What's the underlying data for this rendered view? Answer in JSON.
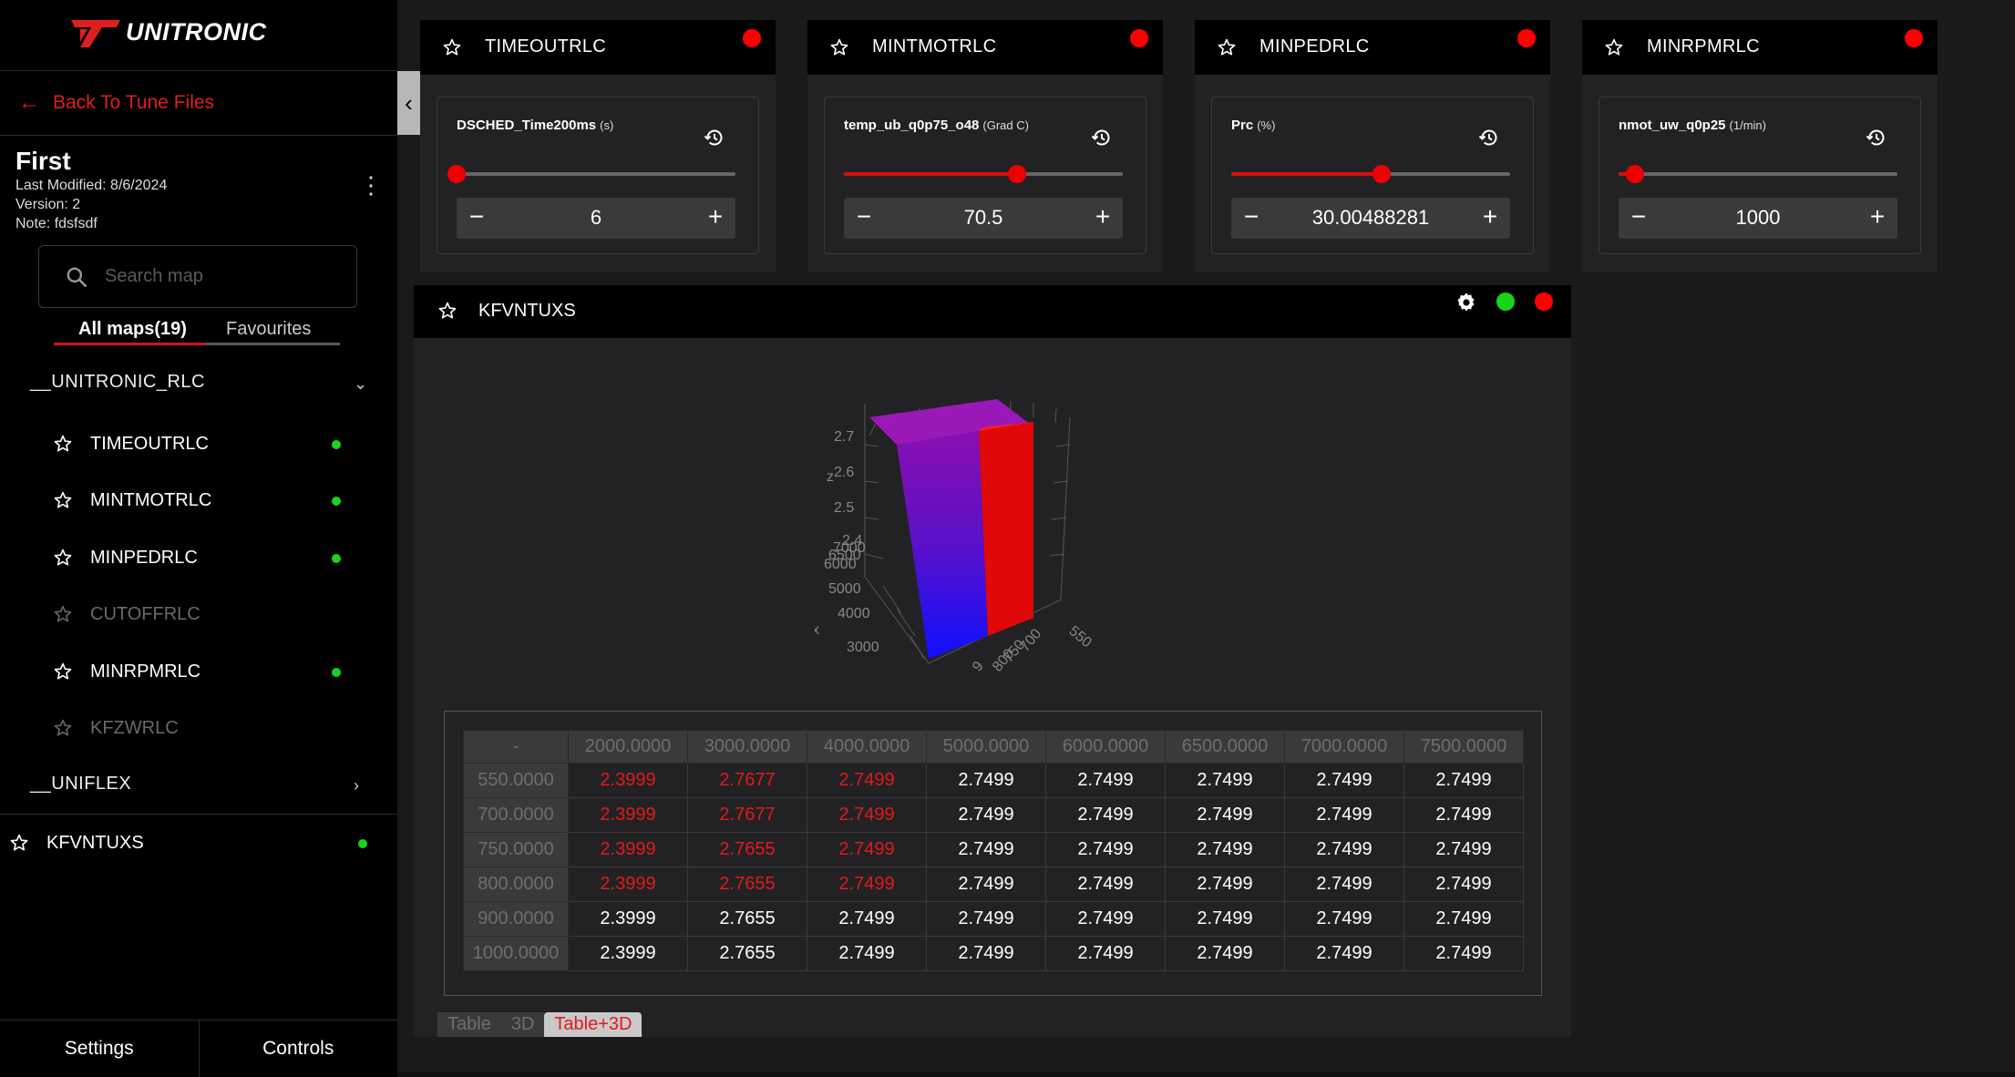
{
  "brand": {
    "name": "UNITRONIC",
    "accent": "#e01e1e"
  },
  "sidebar": {
    "back_label": "Back To Tune Files",
    "tune": {
      "title": "First",
      "last_modified": "Last Modified: 8/6/2024",
      "version": "Version: 2",
      "note": "Note: fdsfsdf"
    },
    "search_placeholder": "Search map",
    "tabs": {
      "all": "All maps(19)",
      "favourites": "Favourites"
    },
    "groups": [
      {
        "name": "__UNITRONIC_RLC",
        "expanded": true
      },
      {
        "name": "__UNIFLEX",
        "expanded": false
      }
    ],
    "items": [
      {
        "label": "TIMEOUTRLC",
        "active": true
      },
      {
        "label": "MINTMOTRLC",
        "active": true
      },
      {
        "label": "MINPEDRLC",
        "active": true
      },
      {
        "label": "CUTOFFRLC",
        "active": false
      },
      {
        "label": "MINRPMRLC",
        "active": true
      },
      {
        "label": "KFZWRLC",
        "active": false
      }
    ],
    "standalone": {
      "label": "KFVNTUXS",
      "active": true
    },
    "footer": {
      "settings": "Settings",
      "controls": "Controls"
    }
  },
  "cards": [
    {
      "title": "TIMEOUTRLC",
      "var": "DSCHED_Time200ms",
      "unit": "(s)",
      "value": "6",
      "slider_fraction": 0.0
    },
    {
      "title": "MINTMOTRLC",
      "var": "temp_ub_q0p75_o48",
      "unit": "(Grad C)",
      "value": "70.5",
      "slider_fraction": 0.62
    },
    {
      "title": "MINPEDRLC",
      "var": "Prc",
      "unit": "(%)",
      "value": "30.00488281",
      "slider_fraction": 0.54
    },
    {
      "title": "MINRPMRLC",
      "var": "nmot_uw_q0p25",
      "unit": "(1/min)",
      "value": "1000",
      "slider_fraction": 0.06
    }
  ],
  "map_panel": {
    "title": "KFVNTUXS",
    "plot_labels": {
      "z_axis": "z",
      "x_axis": "x",
      "z_ticks": [
        "2.7",
        "2.6",
        "2.5",
        "2.4"
      ],
      "x_ticks": [
        "7000",
        "6500",
        "6000",
        "5000",
        "4000",
        "3000"
      ],
      "y_ticks": [
        "550",
        "700",
        "750",
        "800",
        "9"
      ]
    },
    "table": {
      "corner": "-",
      "columns": [
        "2000.0000",
        "3000.0000",
        "4000.0000",
        "5000.0000",
        "6000.0000",
        "6500.0000",
        "7000.0000",
        "7500.0000"
      ],
      "rows": [
        {
          "head": "550.0000",
          "cells": [
            "2.3999",
            "2.7677",
            "2.7499",
            "2.7499",
            "2.7499",
            "2.7499",
            "2.7499",
            "2.7499"
          ],
          "red": [
            true,
            true,
            true,
            false,
            false,
            false,
            false,
            false
          ]
        },
        {
          "head": "700.0000",
          "cells": [
            "2.3999",
            "2.7677",
            "2.7499",
            "2.7499",
            "2.7499",
            "2.7499",
            "2.7499",
            "2.7499"
          ],
          "red": [
            true,
            true,
            true,
            false,
            false,
            false,
            false,
            false
          ]
        },
        {
          "head": "750.0000",
          "cells": [
            "2.3999",
            "2.7655",
            "2.7499",
            "2.7499",
            "2.7499",
            "2.7499",
            "2.7499",
            "2.7499"
          ],
          "red": [
            true,
            true,
            true,
            false,
            false,
            false,
            false,
            false
          ]
        },
        {
          "head": "800.0000",
          "cells": [
            "2.3999",
            "2.7655",
            "2.7499",
            "2.7499",
            "2.7499",
            "2.7499",
            "2.7499",
            "2.7499"
          ],
          "red": [
            true,
            true,
            true,
            false,
            false,
            false,
            false,
            false
          ]
        },
        {
          "head": "900.0000",
          "cells": [
            "2.3999",
            "2.7655",
            "2.7499",
            "2.7499",
            "2.7499",
            "2.7499",
            "2.7499",
            "2.7499"
          ],
          "red": [
            false,
            false,
            false,
            false,
            false,
            false,
            false,
            false
          ]
        },
        {
          "head": "1000.0000",
          "cells": [
            "2.3999",
            "2.7655",
            "2.7499",
            "2.7499",
            "2.7499",
            "2.7499",
            "2.7499",
            "2.7499"
          ],
          "red": [
            false,
            false,
            false,
            false,
            false,
            false,
            false,
            false
          ]
        }
      ]
    },
    "view_tabs": [
      "Table",
      "3D",
      "Table+3D"
    ],
    "active_view": "Table+3D"
  },
  "colors": {
    "modified_cell": "#e21a1a",
    "active_dot": "#19d419",
    "status_dot": "#ff0000"
  }
}
